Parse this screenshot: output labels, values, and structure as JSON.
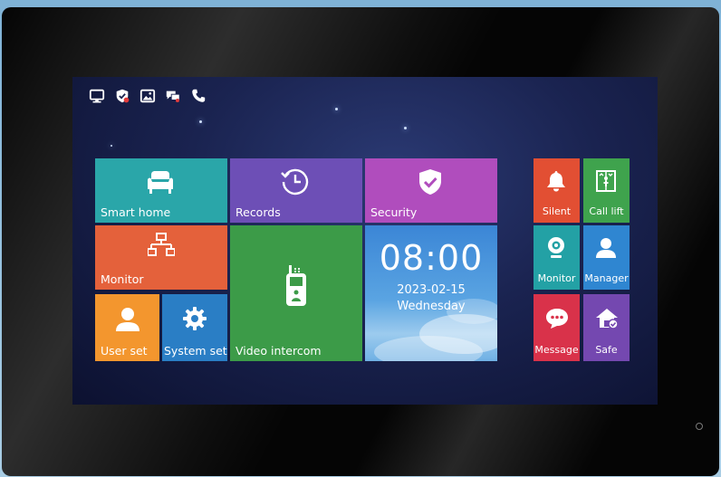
{
  "colors": {
    "teal": "#2aa6a9",
    "purple_records": "#6d4fb6",
    "purple_security": "#b04dbd",
    "orange_monitor": "#e4613b",
    "green_video": "#3c9b48",
    "blue_clock": "#3e89d6",
    "orange_user": "#f3962e",
    "blue_system": "#2a7ec5",
    "red_silent": "#e24f33",
    "green_calllift": "#3fa34d",
    "teal_monitor": "#23a1a5",
    "blue_manager": "#2f86d1",
    "red_message": "#d9324a",
    "purple_safe": "#7448b0"
  },
  "status_bar": {
    "icons": [
      "monitor-icon",
      "shield-alert-icon",
      "image-icon",
      "chat-icon",
      "phone-icon"
    ]
  },
  "tiles": {
    "smart_home": {
      "label": "Smart home",
      "icon": "sofa-icon"
    },
    "records": {
      "label": "Records",
      "icon": "history-clock-icon"
    },
    "security": {
      "label": "Security",
      "icon": "shield-check-icon"
    },
    "monitor": {
      "label": "Monitor",
      "icon": "network-icon"
    },
    "video_intercom": {
      "label": "Video intercom",
      "icon": "intercom-handset-icon"
    },
    "user_set": {
      "label": "User set",
      "icon": "user-icon"
    },
    "system_set": {
      "label": "System set",
      "icon": "gear-icon"
    }
  },
  "clock": {
    "time": "08:00",
    "date": "2023-02-15",
    "day": "Wednesday"
  },
  "side_tiles": {
    "silent": {
      "label": "Silent",
      "icon": "bell-icon"
    },
    "call_lift": {
      "label": "Call lift",
      "icon": "elevator-icon"
    },
    "monitor": {
      "label": "Monitor",
      "icon": "camera-icon"
    },
    "manager": {
      "label": "Manager",
      "icon": "person-icon"
    },
    "message": {
      "label": "Message",
      "icon": "message-bubble-icon"
    },
    "safe": {
      "label": "Safe",
      "icon": "home-shield-icon"
    }
  }
}
